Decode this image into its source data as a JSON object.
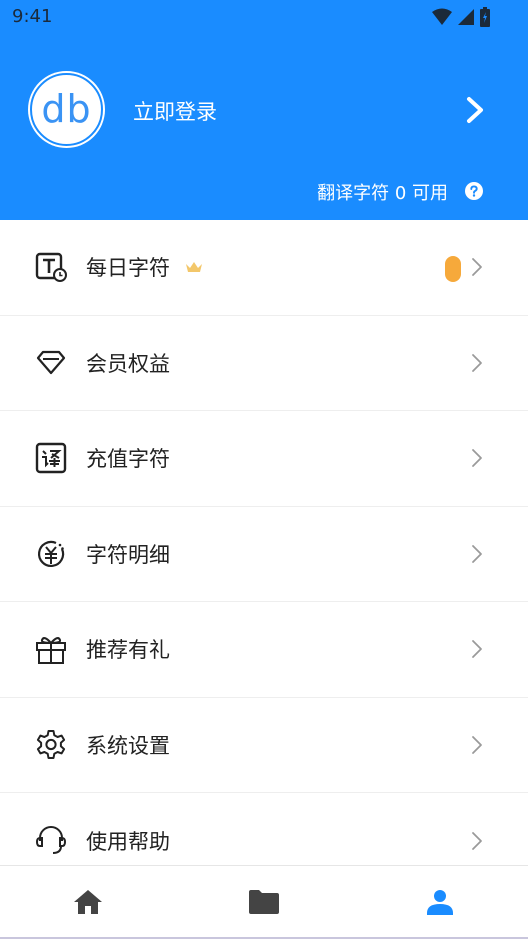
{
  "status_bar": {
    "time": "9:41"
  },
  "header": {
    "avatar_text": "db",
    "login_label": "立即登录",
    "quota_text": "翻译字符 0 可用"
  },
  "menu": {
    "items": [
      {
        "label": "每日字符",
        "icon": "daily-characters-icon"
      },
      {
        "label": "会员权益",
        "icon": "diamond-icon"
      },
      {
        "label": "充值字符",
        "icon": "translate-recharge-icon"
      },
      {
        "label": "字符明细",
        "icon": "yuan-coin-icon"
      },
      {
        "label": "推荐有礼",
        "icon": "gift-icon"
      },
      {
        "label": "系统设置",
        "icon": "gear-icon"
      },
      {
        "label": "使用帮助",
        "icon": "headset-icon"
      }
    ]
  },
  "bottom_nav": {
    "items": [
      "home-icon",
      "folder-icon",
      "profile-icon"
    ],
    "active": "profile-icon"
  },
  "colors": {
    "brand_blue": "#1a8cff",
    "active_tab": "#1a8cff",
    "inactive_tab": "#444444",
    "badge_orange": "#f6a93b",
    "crown_gold": "#f3c76a"
  }
}
